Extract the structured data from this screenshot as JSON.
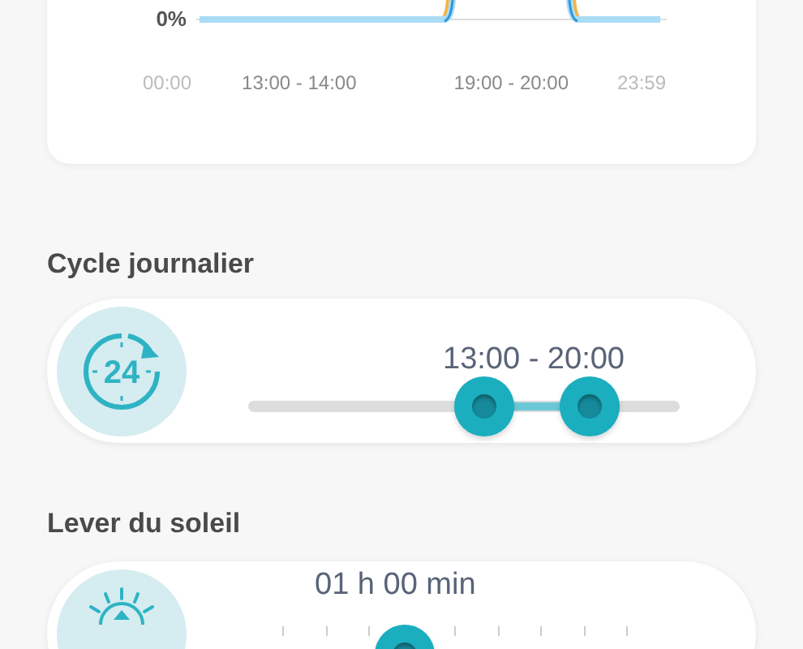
{
  "chart_card": {
    "y_tick": "0%",
    "x_labels": [
      {
        "text": "00:00",
        "kind": "end"
      },
      {
        "text": "13:00 - 14:00",
        "kind": "period"
      },
      {
        "text": "19:00 - 20:00",
        "kind": "period"
      },
      {
        "text": "23:59",
        "kind": "end"
      }
    ]
  },
  "daily_cycle": {
    "heading": "Cycle journalier",
    "icon_text": "24",
    "reading": "13:00 - 20:00",
    "thumbs": [
      {
        "level": 0.545
      },
      {
        "level": 0.79
      }
    ]
  },
  "sunrise": {
    "heading": "Lever du soleil",
    "reading": "01 h 00 min",
    "level": 0.35
  }
}
